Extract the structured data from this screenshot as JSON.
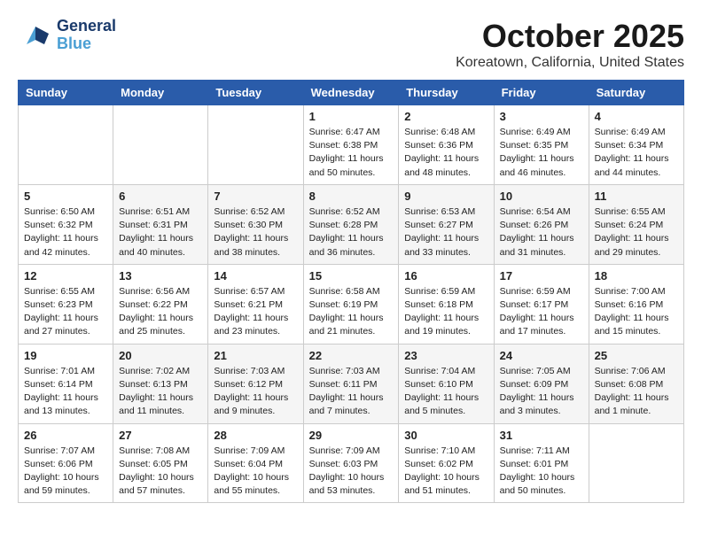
{
  "header": {
    "logo_general": "General",
    "logo_blue": "Blue",
    "title": "October 2025",
    "subtitle": "Koreatown, California, United States"
  },
  "weekdays": [
    "Sunday",
    "Monday",
    "Tuesday",
    "Wednesday",
    "Thursday",
    "Friday",
    "Saturday"
  ],
  "weeks": [
    [
      {
        "day": "",
        "info": ""
      },
      {
        "day": "",
        "info": ""
      },
      {
        "day": "",
        "info": ""
      },
      {
        "day": "1",
        "info": "Sunrise: 6:47 AM\nSunset: 6:38 PM\nDaylight: 11 hours\nand 50 minutes."
      },
      {
        "day": "2",
        "info": "Sunrise: 6:48 AM\nSunset: 6:36 PM\nDaylight: 11 hours\nand 48 minutes."
      },
      {
        "day": "3",
        "info": "Sunrise: 6:49 AM\nSunset: 6:35 PM\nDaylight: 11 hours\nand 46 minutes."
      },
      {
        "day": "4",
        "info": "Sunrise: 6:49 AM\nSunset: 6:34 PM\nDaylight: 11 hours\nand 44 minutes."
      }
    ],
    [
      {
        "day": "5",
        "info": "Sunrise: 6:50 AM\nSunset: 6:32 PM\nDaylight: 11 hours\nand 42 minutes."
      },
      {
        "day": "6",
        "info": "Sunrise: 6:51 AM\nSunset: 6:31 PM\nDaylight: 11 hours\nand 40 minutes."
      },
      {
        "day": "7",
        "info": "Sunrise: 6:52 AM\nSunset: 6:30 PM\nDaylight: 11 hours\nand 38 minutes."
      },
      {
        "day": "8",
        "info": "Sunrise: 6:52 AM\nSunset: 6:28 PM\nDaylight: 11 hours\nand 36 minutes."
      },
      {
        "day": "9",
        "info": "Sunrise: 6:53 AM\nSunset: 6:27 PM\nDaylight: 11 hours\nand 33 minutes."
      },
      {
        "day": "10",
        "info": "Sunrise: 6:54 AM\nSunset: 6:26 PM\nDaylight: 11 hours\nand 31 minutes."
      },
      {
        "day": "11",
        "info": "Sunrise: 6:55 AM\nSunset: 6:24 PM\nDaylight: 11 hours\nand 29 minutes."
      }
    ],
    [
      {
        "day": "12",
        "info": "Sunrise: 6:55 AM\nSunset: 6:23 PM\nDaylight: 11 hours\nand 27 minutes."
      },
      {
        "day": "13",
        "info": "Sunrise: 6:56 AM\nSunset: 6:22 PM\nDaylight: 11 hours\nand 25 minutes."
      },
      {
        "day": "14",
        "info": "Sunrise: 6:57 AM\nSunset: 6:21 PM\nDaylight: 11 hours\nand 23 minutes."
      },
      {
        "day": "15",
        "info": "Sunrise: 6:58 AM\nSunset: 6:19 PM\nDaylight: 11 hours\nand 21 minutes."
      },
      {
        "day": "16",
        "info": "Sunrise: 6:59 AM\nSunset: 6:18 PM\nDaylight: 11 hours\nand 19 minutes."
      },
      {
        "day": "17",
        "info": "Sunrise: 6:59 AM\nSunset: 6:17 PM\nDaylight: 11 hours\nand 17 minutes."
      },
      {
        "day": "18",
        "info": "Sunrise: 7:00 AM\nSunset: 6:16 PM\nDaylight: 11 hours\nand 15 minutes."
      }
    ],
    [
      {
        "day": "19",
        "info": "Sunrise: 7:01 AM\nSunset: 6:14 PM\nDaylight: 11 hours\nand 13 minutes."
      },
      {
        "day": "20",
        "info": "Sunrise: 7:02 AM\nSunset: 6:13 PM\nDaylight: 11 hours\nand 11 minutes."
      },
      {
        "day": "21",
        "info": "Sunrise: 7:03 AM\nSunset: 6:12 PM\nDaylight: 11 hours\nand 9 minutes."
      },
      {
        "day": "22",
        "info": "Sunrise: 7:03 AM\nSunset: 6:11 PM\nDaylight: 11 hours\nand 7 minutes."
      },
      {
        "day": "23",
        "info": "Sunrise: 7:04 AM\nSunset: 6:10 PM\nDaylight: 11 hours\nand 5 minutes."
      },
      {
        "day": "24",
        "info": "Sunrise: 7:05 AM\nSunset: 6:09 PM\nDaylight: 11 hours\nand 3 minutes."
      },
      {
        "day": "25",
        "info": "Sunrise: 7:06 AM\nSunset: 6:08 PM\nDaylight: 11 hours\nand 1 minute."
      }
    ],
    [
      {
        "day": "26",
        "info": "Sunrise: 7:07 AM\nSunset: 6:06 PM\nDaylight: 10 hours\nand 59 minutes."
      },
      {
        "day": "27",
        "info": "Sunrise: 7:08 AM\nSunset: 6:05 PM\nDaylight: 10 hours\nand 57 minutes."
      },
      {
        "day": "28",
        "info": "Sunrise: 7:09 AM\nSunset: 6:04 PM\nDaylight: 10 hours\nand 55 minutes."
      },
      {
        "day": "29",
        "info": "Sunrise: 7:09 AM\nSunset: 6:03 PM\nDaylight: 10 hours\nand 53 minutes."
      },
      {
        "day": "30",
        "info": "Sunrise: 7:10 AM\nSunset: 6:02 PM\nDaylight: 10 hours\nand 51 minutes."
      },
      {
        "day": "31",
        "info": "Sunrise: 7:11 AM\nSunset: 6:01 PM\nDaylight: 10 hours\nand 50 minutes."
      },
      {
        "day": "",
        "info": ""
      }
    ]
  ]
}
